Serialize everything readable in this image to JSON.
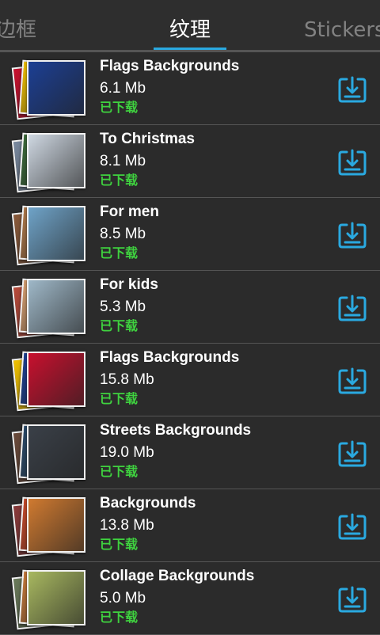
{
  "tabs": [
    {
      "label": "边框"
    },
    {
      "label": "纹理"
    },
    {
      "label": "Stickers"
    }
  ],
  "colors": {
    "accent": "#2aa9e0",
    "downloaded": "#3fd23f",
    "background": "#2b2b2b"
  },
  "items": [
    {
      "title": "Flags Backgrounds",
      "size": "6.1 Mb",
      "status": "已下载",
      "thumb": [
        "#c8102e",
        "#f2c200",
        "#1c3f94"
      ],
      "icon": "download-icon"
    },
    {
      "title": "To Christmas",
      "size": "8.1 Mb",
      "status": "已下载",
      "thumb": [
        "#7a8aa0",
        "#3c6b3a",
        "#cfd8e2"
      ],
      "icon": "download-icon"
    },
    {
      "title": "For men",
      "size": "8.5 Mb",
      "status": "已下载",
      "thumb": [
        "#8a5a3a",
        "#b07a4a",
        "#6fa3c8"
      ],
      "icon": "download-icon"
    },
    {
      "title": "For kids",
      "size": "5.3 Mb",
      "status": "已下载",
      "thumb": [
        "#b84a3a",
        "#d8a070",
        "#9fb8c8"
      ],
      "icon": "download-icon"
    },
    {
      "title": "Flags Backgrounds",
      "size": "15.8 Mb",
      "status": "已下载",
      "thumb": [
        "#f2c200",
        "#1c3f94",
        "#c8102e"
      ],
      "icon": "download-icon"
    },
    {
      "title": "Streets Backgrounds",
      "size": "19.0 Mb",
      "status": "已下载",
      "thumb": [
        "#6a4a3a",
        "#2a4a6a",
        "#3a4048"
      ],
      "icon": "download-icon"
    },
    {
      "title": "Backgrounds",
      "size": "13.8 Mb",
      "status": "已下载",
      "thumb": [
        "#8a3a3a",
        "#c84a2a",
        "#d07a30"
      ],
      "icon": "download-icon"
    },
    {
      "title": "Collage Backgrounds",
      "size": "5.0 Mb",
      "status": "已下载",
      "thumb": [
        "#6a7a5a",
        "#c87a3a",
        "#a8b860"
      ],
      "icon": "download-icon"
    }
  ]
}
